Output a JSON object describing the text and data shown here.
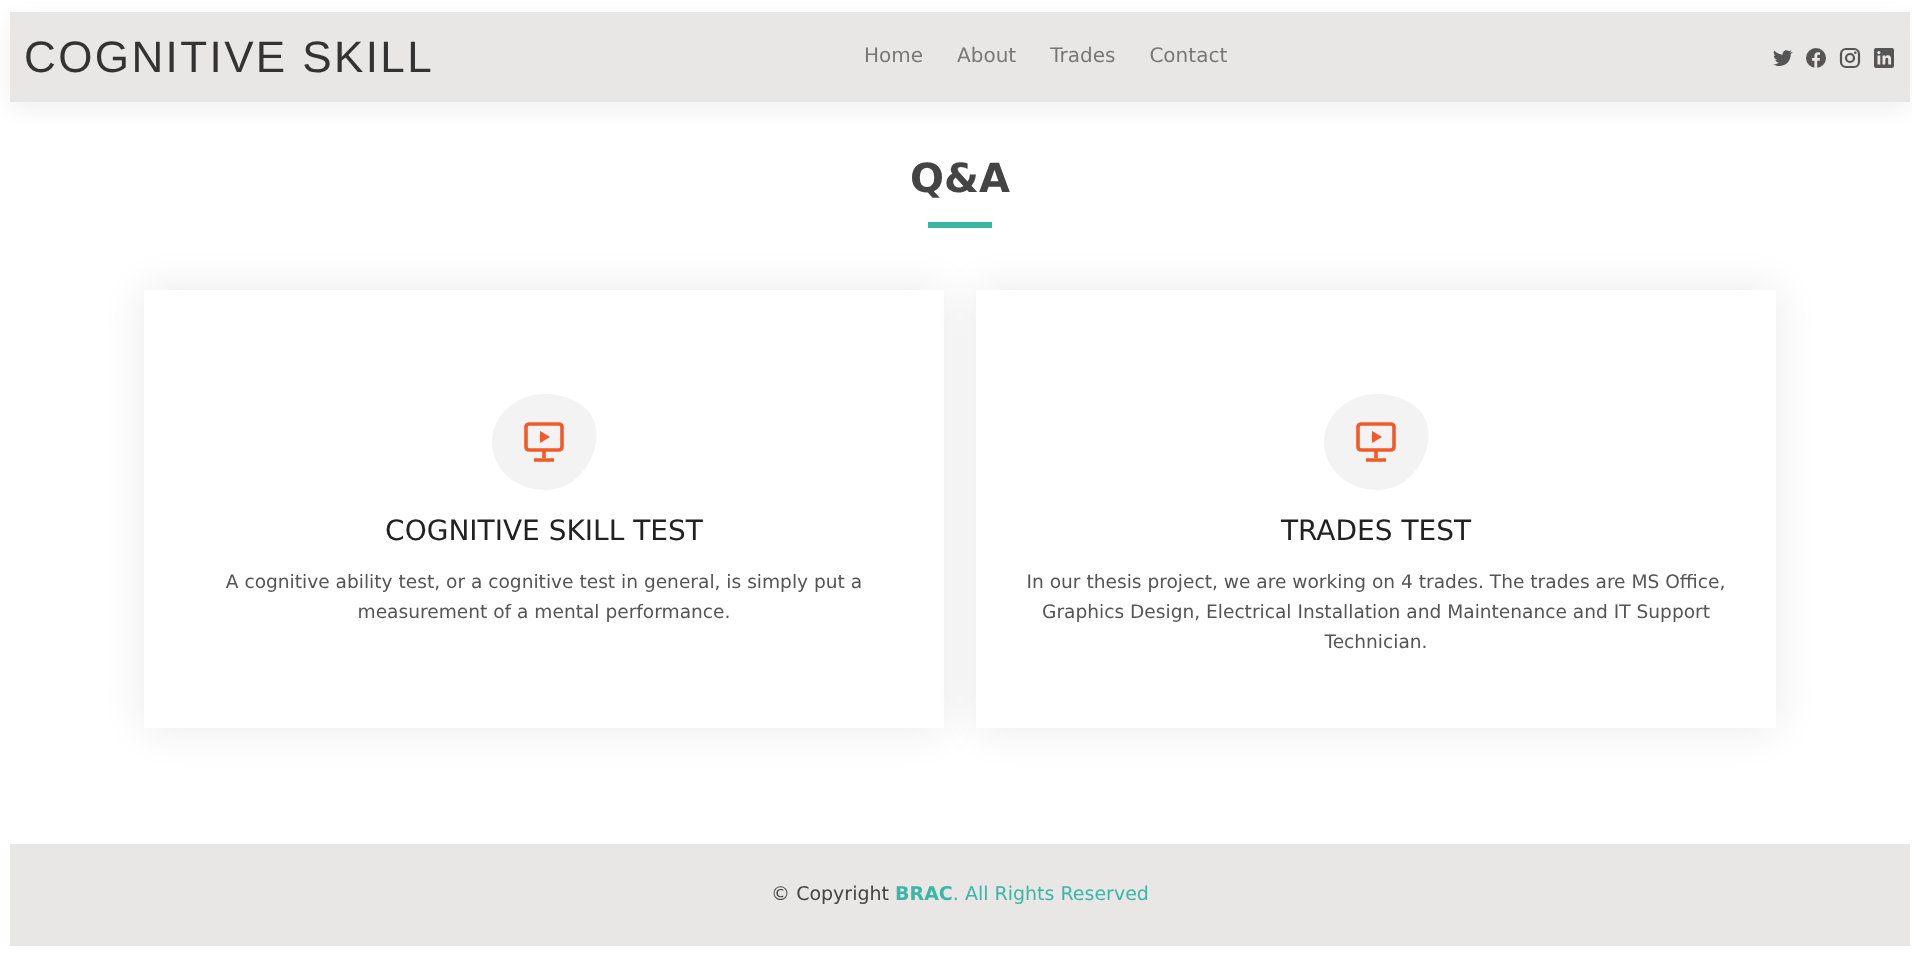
{
  "brand": "COGNITIVE SKILL",
  "nav": [
    "Home",
    "About",
    "Trades",
    "Contact"
  ],
  "social": [
    {
      "kind": "twitter"
    },
    {
      "kind": "facebook"
    },
    {
      "kind": "instagram"
    },
    {
      "kind": "linkedin"
    }
  ],
  "section_title": "Q&A",
  "cards": [
    {
      "title": "COGNITIVE SKILL TEST",
      "text": "A cognitive ability test, or a cognitive test in general, is simply put a measurement of a mental performance."
    },
    {
      "title": "TRADES TEST",
      "text": "In our thesis project, we are working on 4 trades. The trades are MS Office, Graphics Design, Electrical Installation and Maintenance and IT Support Technician."
    }
  ],
  "footer": {
    "prefix": "© Copyright ",
    "brand": "BRAC",
    "suffix": ". All Rights Reserved"
  }
}
